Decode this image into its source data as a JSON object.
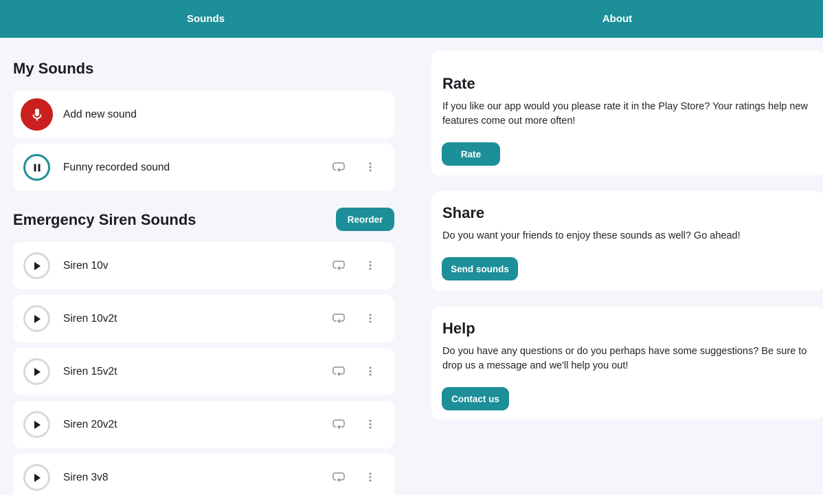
{
  "tabs": {
    "sounds_label": "Sounds",
    "about_label": "About"
  },
  "my_sounds": {
    "title": "My Sounds",
    "add_new_label": "Add new sound",
    "items": [
      {
        "label": "Funny recorded sound",
        "state": "playing"
      }
    ]
  },
  "siren": {
    "title": "Emergency Siren Sounds",
    "reorder_label": "Reorder",
    "items": [
      {
        "label": "Siren 10v"
      },
      {
        "label": "Siren 10v2t"
      },
      {
        "label": "Siren 15v2t"
      },
      {
        "label": "Siren 20v2t"
      },
      {
        "label": "Siren 3v8"
      }
    ]
  },
  "about": {
    "rate": {
      "title": "Rate",
      "text": "If you like our app would you please rate it in the Play Store? Your ratings help new features come out more often!",
      "button": "Rate"
    },
    "share": {
      "title": "Share",
      "text": "Do you want your friends to enjoy these sounds as well? Go ahead!",
      "button": "Send sounds"
    },
    "help": {
      "title": "Help",
      "text": "Do you have any questions or do you perhaps have some suggestions? Be sure to drop us a message and we'll help you out!",
      "button": "Contact us"
    }
  },
  "icons": {
    "mic": "microphone-icon",
    "play": "play-icon",
    "pause": "pause-icon",
    "loop": "loop-icon",
    "more": "more-vertical-icon"
  },
  "colors": {
    "accent": "#1c8f98",
    "record": "#c9201f",
    "background": "#f5f6fb"
  }
}
